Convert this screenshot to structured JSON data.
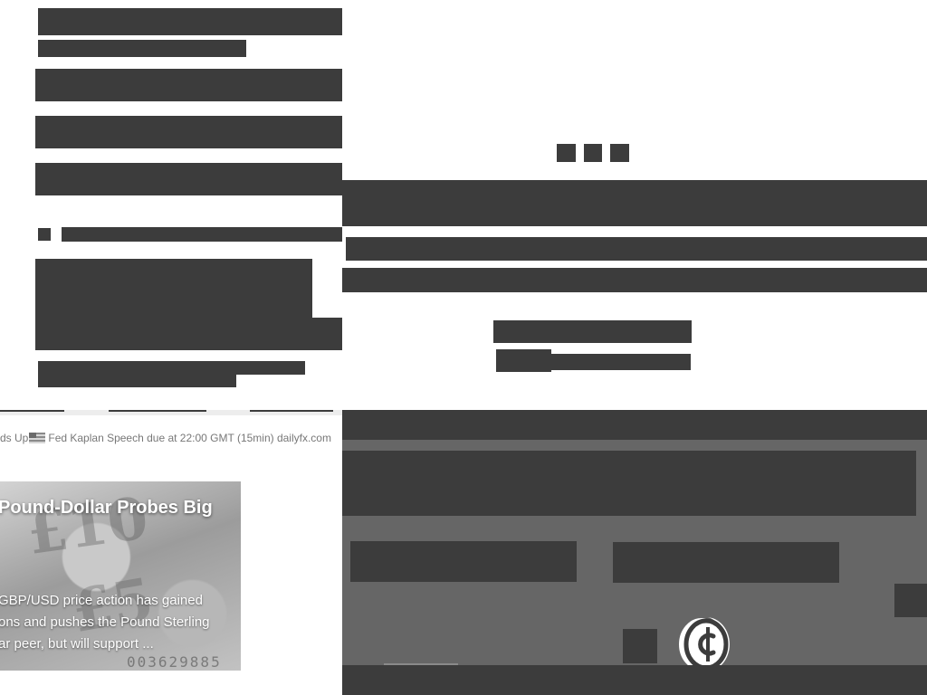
{
  "ticker": {
    "prefix": "ds Up",
    "text": "Fed Kaplan Speech due at 22:00 GMT (15min) dailyfx.com"
  },
  "news_card": {
    "title": "Pound-Dollar Probes Big",
    "description_lines": [
      "GBP/USD price action has gained",
      "ons and pushes the Pound Sterling",
      "ar peer, but will support ..."
    ],
    "bg_text_1": "£10",
    "bg_text_2": "£5",
    "serial": "003629885"
  },
  "icons": {
    "flag": "us-flag-icon",
    "coin": "cent-coin-icon"
  },
  "colors": {
    "skeleton": "#3c3c3c",
    "overlay": "#666666",
    "ticker_text": "#777777"
  }
}
